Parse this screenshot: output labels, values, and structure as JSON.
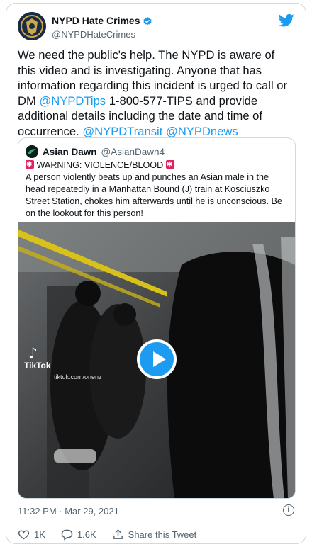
{
  "author": {
    "display_name": "NYPD Hate Crimes",
    "handle": "@NYPDHateCrimes",
    "verified": true
  },
  "tweet": {
    "text_segments": [
      {
        "text": "We need the public's help. The NYPD is aware of this video and is investigating. Anyone that has information regarding this incident is urged to call or DM ",
        "link": false
      },
      {
        "text": "@NYPDTips",
        "link": true
      },
      {
        "text": " 1-800-577-TIPS and provide additional details including the date and time of occurrence.  ",
        "link": false
      },
      {
        "text": "@NYPDTransit",
        "link": true
      },
      {
        "text": " ",
        "link": false
      },
      {
        "text": "@NYPDnews",
        "link": true
      }
    ]
  },
  "quoted_tweet": {
    "display_name": "Asian Dawn",
    "handle": "@AsianDawn4",
    "warning": "WARNING: VIOLENCE/BLOOD",
    "text": "A person violently beats up and punches an Asian male in the head repeatedly in a Manhattan Bound (J) train at Kosciuszko Street Station, chokes him afterwards until he is unconscious. Be on the lookout for this person!",
    "video": {
      "watermark": "TikTok",
      "watermark_url": "tiktok.com/onenz"
    }
  },
  "meta": {
    "timestamp": "11:32 PM · Mar 29, 2021"
  },
  "actions": {
    "likes": "1K",
    "replies": "1.6K",
    "share_label": "Share this Tweet"
  },
  "colors": {
    "link": "#1d9bf0",
    "secondary_text": "#536471",
    "border": "#cfd9de",
    "siren": "#e0245e"
  },
  "icons": [
    "twitter-bird-icon",
    "verified-badge-icon",
    "siren-icon",
    "play-icon",
    "info-icon",
    "heart-icon",
    "reply-icon",
    "share-icon"
  ]
}
